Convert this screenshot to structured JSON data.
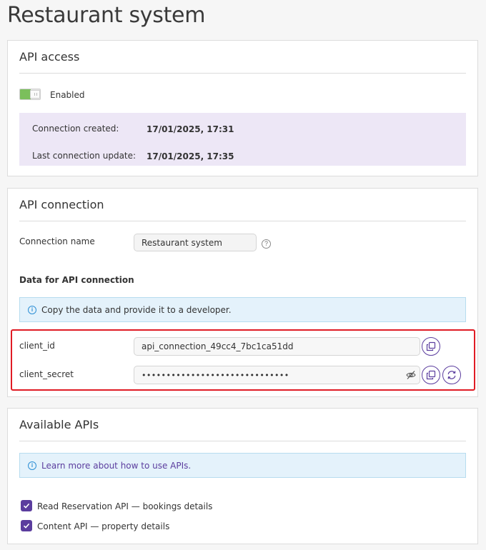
{
  "page": {
    "title": "Restaurant system"
  },
  "api_access": {
    "title": "API access",
    "toggle": {
      "label": "Enabled",
      "on": true
    },
    "rows": [
      {
        "label": "Connection created:",
        "value": "17/01/2025, 17:31"
      },
      {
        "label": "Last connection update:",
        "value": "17/01/2025, 17:35"
      }
    ]
  },
  "api_connection": {
    "title": "API connection",
    "name_label": "Connection name",
    "name_value": "Restaurant system",
    "help_icon": "question-circle-icon",
    "data_heading": "Data for API connection",
    "notice": "Copy the data and provide it to a developer.",
    "client_id": {
      "label": "client_id",
      "value": "api_connection_49cc4_7bc1ca51dd"
    },
    "client_secret": {
      "label": "client_secret",
      "value": "••••••••••••••••••••••••••••••"
    },
    "icons": {
      "copy": "copy-icon",
      "eye_hidden": "eye-slash-icon",
      "refresh": "refresh-icon"
    }
  },
  "available_apis": {
    "title": "Available APIs",
    "notice_link": "Learn more about how to use APIs.",
    "items": [
      {
        "label": "Read Reservation API — bookings details",
        "checked": true
      },
      {
        "label": "Content API — property details",
        "checked": true
      }
    ]
  },
  "colors": {
    "accent": "#5b3d9e",
    "toggle_on": "#7bbf5c",
    "highlight": "#e01b24",
    "info_bg": "#e4f2fb",
    "panel_bg": "#ede7f6"
  }
}
